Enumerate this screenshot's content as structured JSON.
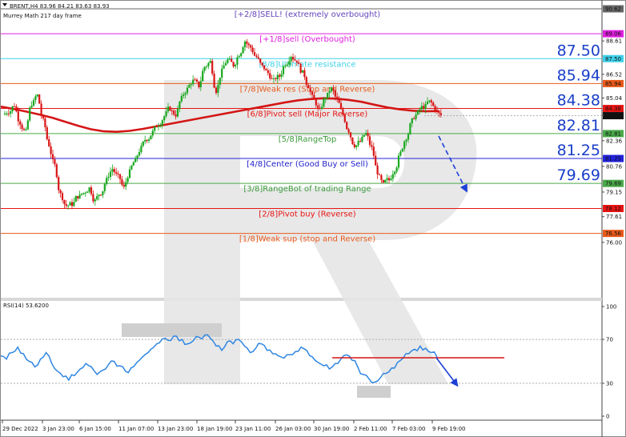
{
  "header": {
    "symbol_line": "BRENT,H4  83.96 84.21 83.63 83.93",
    "indicator": "Murrey Math 217 day frame",
    "rsi_label": "RSI(14) 53.6200"
  },
  "colors": {
    "candle_up": "#18a81e",
    "candle_down": "#d91414",
    "ma": "#d41616",
    "rsi": "#2f86e2",
    "arrow": "#1c3fd6",
    "big_label": "#1a3ec9",
    "watermark": "#e6e6e6"
  },
  "chart_data": [
    {
      "type": "candlestick",
      "symbol": "BRENT",
      "timeframe": "H4",
      "x_tick_labels": [
        "29 Dec 2022",
        "3 Jan 23:00",
        "6 Jan 15:00",
        "11 Jan 07:00",
        "13 Jan 23:00",
        "18 Jan 19:00",
        "23 Jan 11:00",
        "26 Jan 03:00",
        "30 Jan 19:00",
        "2 Feb 11:00",
        "7 Feb 03:00",
        "9 Feb 19:00"
      ],
      "y_tick_labels": [
        "88.61",
        "86.52",
        "85.04",
        "83.95",
        "82.36",
        "80.76",
        "79.15",
        "77.61",
        "76.00"
      ],
      "ylim": [
        75.6,
        90.62
      ],
      "murrey_levels": [
        {
          "label": "[+2/8]SELL! (extremely overbought)",
          "value": 90.62,
          "color": "#666666",
          "text_color": "#6644bb"
        },
        {
          "label": "[+1/8]sell (Overbought)",
          "value": 89.06,
          "color": "#e020e0",
          "text_color": "#e020e0"
        },
        {
          "label": "[8/8]Ultimate resistance",
          "value": 87.5,
          "color": "#3ed0e8",
          "text_color": "#3ed0e8"
        },
        {
          "label": "[7/8]Weak res (Stop and Reverse)",
          "value": 85.94,
          "color": "#e85a1a",
          "text_color": "#e85a1a"
        },
        {
          "label": "[6/8]Pivot sell (Major Reverse)",
          "value": 84.38,
          "color": "#e81414",
          "text_color": "#e81414"
        },
        {
          "label": "[5/8]RangeTop",
          "value": 82.81,
          "color": "#4aaa4a",
          "text_color": "#3a9a3a"
        },
        {
          "label": "[4/8]Center (Good Buy or Sell)",
          "value": 81.25,
          "color": "#2222dd",
          "text_color": "#2222cc"
        },
        {
          "label": "[3/8]RangeBot of trading Range",
          "value": 79.69,
          "color": "#4aaa4a",
          "text_color": "#3a9a3a"
        },
        {
          "label": "[2/8]Pivot buy (Reverse)",
          "value": 78.12,
          "color": "#e81414",
          "text_color": "#e81414"
        },
        {
          "label": "[1/8]Weak sup (stop and Reverse)",
          "value": 76.56,
          "color": "#e85a1a",
          "text_color": "#e85a1a"
        }
      ],
      "price_tags": [
        {
          "text": "90.62",
          "value": 90.62,
          "bg": "#666666"
        },
        {
          "text": "89.06",
          "value": 89.06,
          "bg": "#e020e0"
        },
        {
          "text": "87.50",
          "value": 87.5,
          "bg": "#3ed0e8"
        },
        {
          "text": "85.94",
          "value": 85.94,
          "bg": "#e85a1a"
        },
        {
          "text": "84.38",
          "value": 84.38,
          "bg": "#e81414"
        },
        {
          "text": "83.93",
          "value": 83.93,
          "bg": "#111111"
        },
        {
          "text": "82.81",
          "value": 82.81,
          "bg": "#4aaa4a"
        },
        {
          "text": "81.25",
          "value": 81.25,
          "bg": "#2222dd"
        },
        {
          "text": "79.69",
          "value": 79.69,
          "bg": "#4aaa4a"
        },
        {
          "text": "78.12",
          "value": 78.12,
          "bg": "#e81414"
        },
        {
          "text": "76.56",
          "value": 76.56,
          "bg": "#e85a1a"
        }
      ],
      "big_labels": [
        {
          "text": "87.50",
          "value": 87.5
        },
        {
          "text": "85.94",
          "value": 85.94
        },
        {
          "text": "84.38",
          "value": 84.38
        },
        {
          "text": "82.81",
          "value": 82.81
        },
        {
          "text": "81.25",
          "value": 81.25
        },
        {
          "text": "79.69",
          "value": 79.69
        }
      ],
      "last_price": 83.93,
      "close_path": [
        84.2,
        84.6,
        83.5,
        82.9,
        84.7,
        85.2,
        83.6,
        82.1,
        80.8,
        79.0,
        78.3,
        78.4,
        78.9,
        79.1,
        79.4,
        78.6,
        79.1,
        79.9,
        80.6,
        80.1,
        79.4,
        80.4,
        81.1,
        81.9,
        82.5,
        82.9,
        83.4,
        83.9,
        84.4,
        84.0,
        85.0,
        85.6,
        86.1,
        85.8,
        87.0,
        87.3,
        85.5,
        86.7,
        87.4,
        87.1,
        87.8,
        88.6,
        88.2,
        87.6,
        87.0,
        86.6,
        86.1,
        86.4,
        87.2,
        87.7,
        87.4,
        86.6,
        85.8,
        84.9,
        84.2,
        85.1,
        85.6,
        84.9,
        84.0,
        83.0,
        82.1,
        82.3,
        82.8,
        81.9,
        80.4,
        79.6,
        79.9,
        80.6,
        81.6,
        82.6,
        83.6,
        84.1,
        84.5,
        84.8,
        84.4,
        83.93
      ],
      "ma_path": [
        84.5,
        84.35,
        84.18,
        84.0,
        83.8,
        83.55,
        83.3,
        83.08,
        82.95,
        82.92,
        82.98,
        83.1,
        83.25,
        83.4,
        83.55,
        83.7,
        83.85,
        84.0,
        84.15,
        84.3,
        84.45,
        84.6,
        84.75,
        84.88,
        84.97,
        85.02,
        85.0,
        84.92,
        84.8,
        84.62,
        84.45,
        84.32,
        84.24,
        84.2,
        84.22
      ],
      "annotation": "blue arrow pointing down from last candle toward 81.25 area"
    },
    {
      "type": "line",
      "name": "RSI(14)",
      "value": 53.62,
      "y_tick_labels": [
        "100",
        "70",
        "30",
        "0"
      ],
      "ylim": [
        0,
        100
      ],
      "levels": [
        70,
        30
      ],
      "values": [
        55,
        52,
        58,
        63,
        57,
        50,
        45,
        52,
        58,
        48,
        41,
        36,
        33,
        37,
        43,
        48,
        45,
        38,
        42,
        47,
        50,
        46,
        41,
        44,
        49,
        54,
        58,
        63,
        67,
        71,
        69,
        73,
        70,
        66,
        69,
        72,
        74,
        71,
        64,
        60,
        68,
        66,
        70,
        64,
        58,
        62,
        66,
        60,
        57,
        55,
        53,
        56,
        59,
        63,
        60,
        54,
        49,
        46,
        43,
        48,
        52,
        56,
        51,
        45,
        38,
        34,
        31,
        35,
        39,
        44,
        49,
        53,
        57,
        61,
        64,
        62,
        58,
        53.62
      ],
      "resistance_line": 52,
      "annotation": "blue arrow pointing down after trendline break"
    }
  ]
}
